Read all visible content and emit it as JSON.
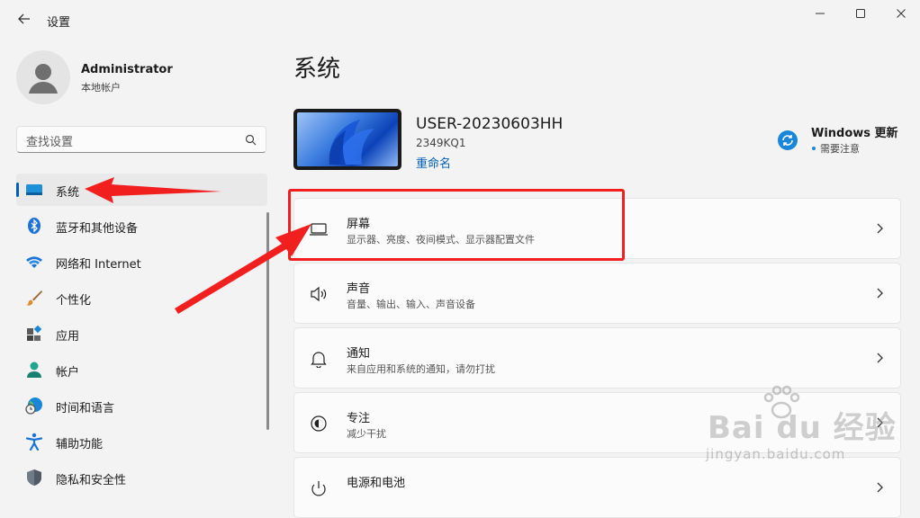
{
  "window": {
    "title": "设置",
    "back_icon": "back-arrow-icon"
  },
  "account": {
    "name": "Administrator",
    "type": "本地帐户"
  },
  "search": {
    "placeholder": "查找设置"
  },
  "nav": {
    "items": [
      {
        "label": "系统",
        "icon": "system-display-icon",
        "active": true
      },
      {
        "label": "蓝牙和其他设备",
        "icon": "bluetooth-icon"
      },
      {
        "label": "网络和 Internet",
        "icon": "wifi-icon"
      },
      {
        "label": "个性化",
        "icon": "paint-brush-icon"
      },
      {
        "label": "应用",
        "icon": "apps-icon"
      },
      {
        "label": "帐户",
        "icon": "account-icon"
      },
      {
        "label": "时间和语言",
        "icon": "globe-clock-icon"
      },
      {
        "label": "辅助功能",
        "icon": "accessibility-icon"
      },
      {
        "label": "隐私和安全性",
        "icon": "shield-icon"
      }
    ]
  },
  "main": {
    "title": "系统",
    "device": {
      "name": "USER-20230603HH",
      "model": "2349KQ1",
      "rename_label": "重命名"
    },
    "windows_update": {
      "title": "Windows 更新",
      "status": "需要注意"
    },
    "cards": [
      {
        "title": "屏幕",
        "subtitle": "显示器、亮度、夜间模式、显示器配置文件",
        "icon": "monitor-icon"
      },
      {
        "title": "声音",
        "subtitle": "音量、输出、输入、声音设备",
        "icon": "speaker-icon"
      },
      {
        "title": "通知",
        "subtitle": "来自应用和系统的通知，请勿打扰",
        "icon": "bell-icon"
      },
      {
        "title": "专注",
        "subtitle": "减少干扰",
        "icon": "focus-icon"
      },
      {
        "title": "电源和电池",
        "subtitle": "",
        "icon": "power-icon"
      }
    ]
  },
  "watermark": {
    "brand": "Bai du 经验",
    "url": "jingyan.baidu.com"
  },
  "colors": {
    "accent": "#005fb8",
    "annotation_red": "#f21f1f",
    "background": "#f3f3f3",
    "card": "#fbfbfb"
  }
}
